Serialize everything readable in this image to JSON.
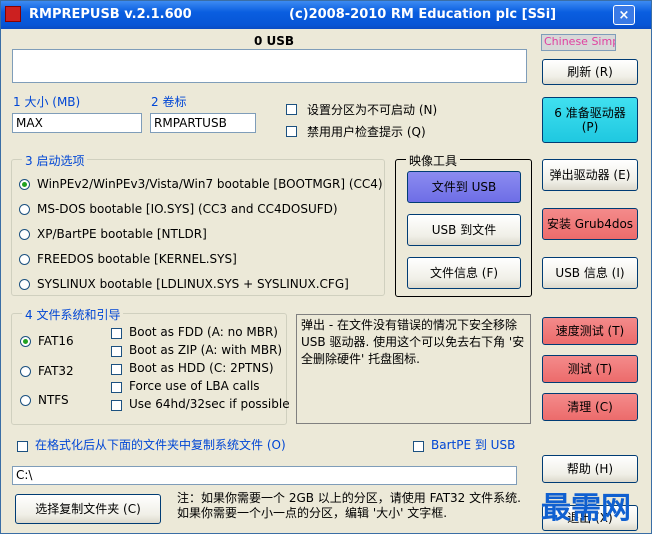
{
  "titlebar": {
    "app": "RMPREPUSB v.2.1.600",
    "copyright": "(c)2008-2010 RM Education plc [SSi]",
    "close": "×"
  },
  "usb_header": "0 USB",
  "language": "Chinese Simp",
  "buttons": {
    "refresh": "刷新 (R)",
    "prepare": "6 准备驱动器 (P)",
    "eject": "弹出驱动器 (E)",
    "install_grub": "安装 Grub4dos",
    "usb_info": "USB 信息 (I)",
    "speed_test": "速度测试 (T)",
    "test": "测试 (T)",
    "clean": "清理 (C)",
    "help": "帮助 (H)",
    "exit": "退出 (X)",
    "choose_folder": "选择复制文件夹 (C)",
    "file_to_usb": "文件到 USB",
    "usb_to_file": "USB 到文件",
    "file_info": "文件信息 (F)"
  },
  "size": {
    "label": "1 大小 (MB)",
    "value": "MAX"
  },
  "volume": {
    "label": "2 卷标",
    "value": "RMPARTUSB"
  },
  "options": {
    "non_bootable": "设置分区为不可启动 (N)",
    "no_user_prompt": "禁用用户检查提示 (Q)"
  },
  "boot": {
    "title": "3 启动选项",
    "items": [
      "WinPEv2/WinPEv3/Vista/Win7 bootable [BOOTMGR] (CC4)",
      "MS-DOS bootable [IO.SYS]    (CC3 and CC4DOSUFD)",
      "XP/BartPE bootable [NTLDR]",
      "FREEDOS bootable [KERNEL.SYS]",
      "SYSLINUX bootable [LDLINUX.SYS + SYSLINUX.CFG]"
    ],
    "selected": 0
  },
  "image_tools": {
    "title": "映像工具"
  },
  "fs": {
    "title": "4 文件系统和引导",
    "items": [
      "FAT16",
      "FAT32",
      "NTFS"
    ],
    "selected": 0,
    "checks": [
      "Boot as FDD (A: no MBR)",
      "Boot as ZIP (A: with MBR)",
      "Boot as HDD (C: 2PTNS)",
      "Force use of LBA calls",
      "Use 64hd/32sec if possible"
    ]
  },
  "info_text": "弹出 - 在文件没有错误的情况下安全移除 USB 驱动器. 使用这个可以免去右下角 '安全删除硬件' 托盘图标.",
  "copy_files": {
    "label": "在格式化后从下面的文件夹中复制系统文件 (O)",
    "path": "C:\\"
  },
  "bartpe": "BartPE 到 USB",
  "note": "注：如果你需要一个 2GB 以上的分区，请使用 FAT32 文件系统. 如果你需要一个小一点的分区，编辑 '大小' 文字框.",
  "watermark": "最需网"
}
